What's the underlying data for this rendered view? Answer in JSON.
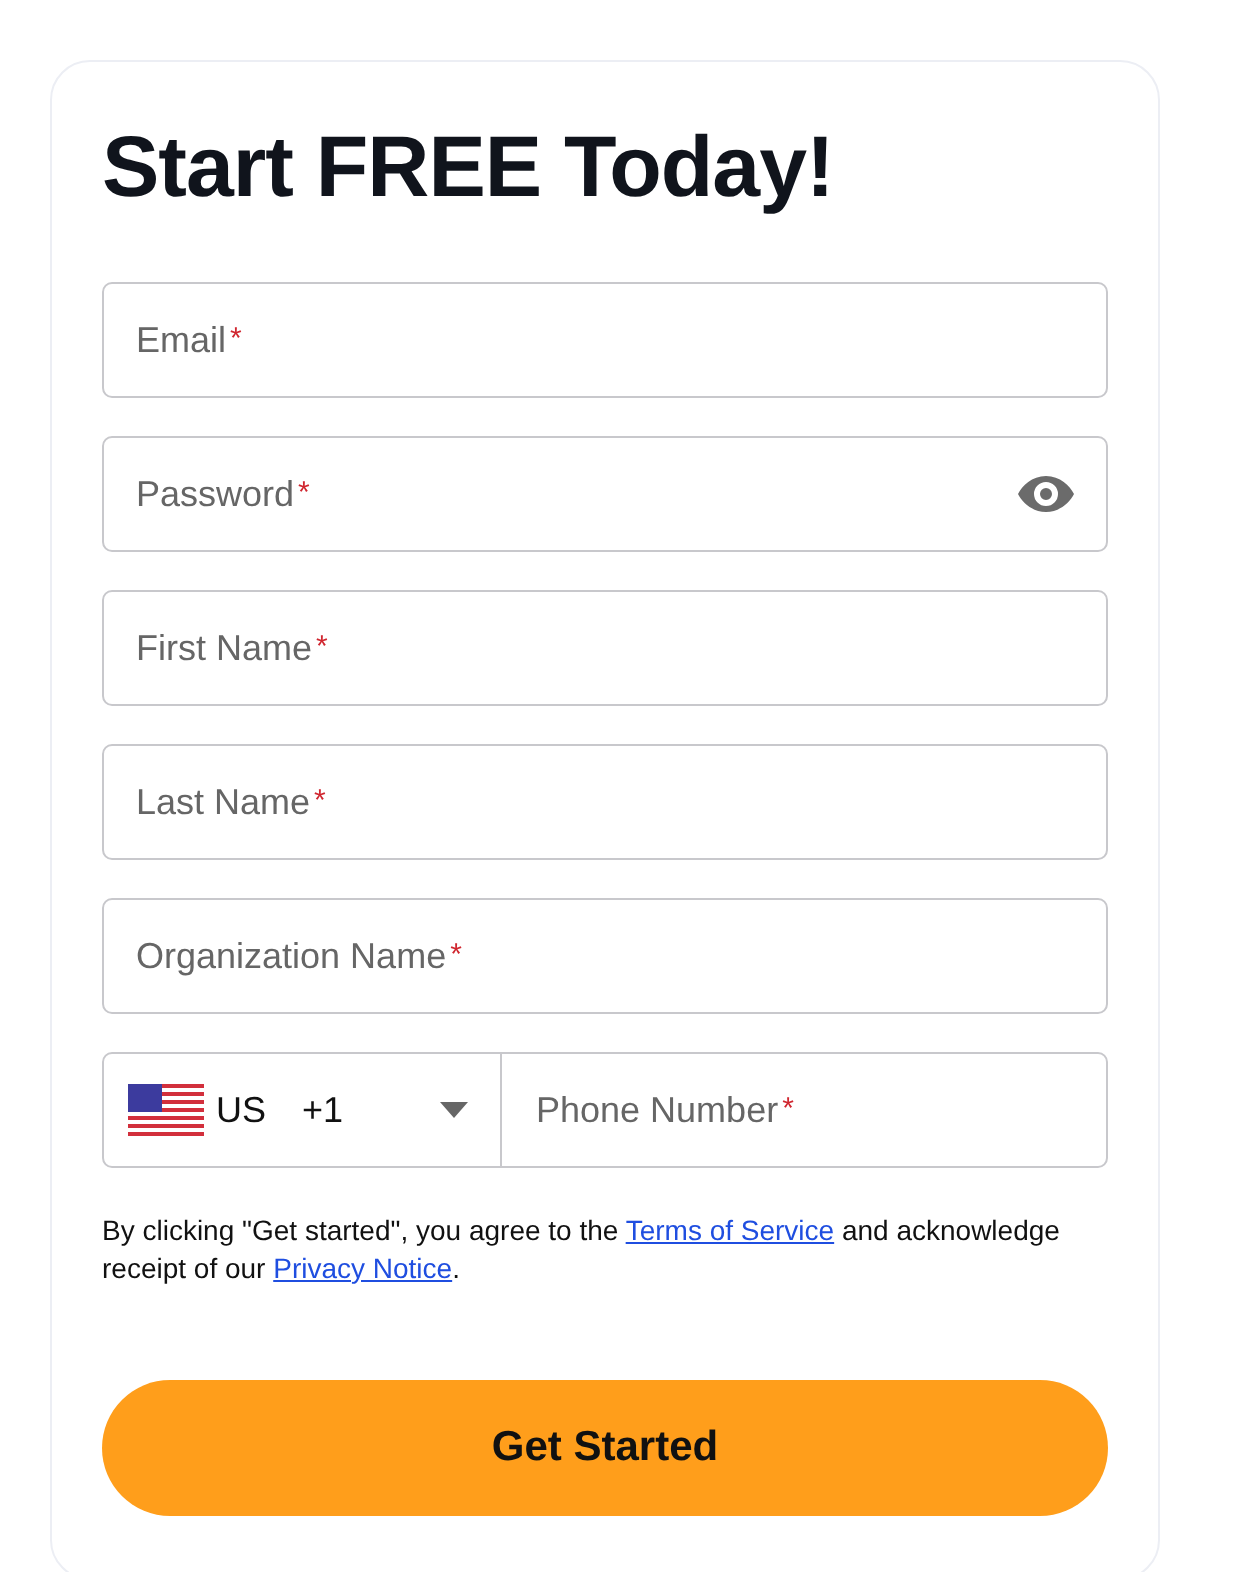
{
  "title": "Start FREE Today!",
  "fields": [
    {
      "kind": "text",
      "placeholder": "Email",
      "mark": "*"
    },
    {
      "kind": "password",
      "placeholder": "Password",
      "mark": "*"
    },
    {
      "kind": "text",
      "placeholder": "First Name",
      "mark": "*"
    },
    {
      "kind": "text",
      "placeholder": "Last Name",
      "mark": "*"
    },
    {
      "kind": "text",
      "placeholder": "Organization Name",
      "mark": "*"
    }
  ],
  "phone": {
    "country": "US",
    "code": "+1",
    "placeholder": "Phone Number",
    "mark": "*"
  },
  "legal": [
    {
      "kind": "text",
      "text": "By clicking \"Get started\", you agree to the "
    },
    {
      "kind": "link",
      "text": "Terms of Service"
    },
    {
      "kind": "text",
      "text": " and acknowledge receipt of our "
    },
    {
      "kind": "link",
      "text": "Privacy Notice"
    },
    {
      "kind": "text",
      "text": "."
    }
  ],
  "submit": "Get Started"
}
